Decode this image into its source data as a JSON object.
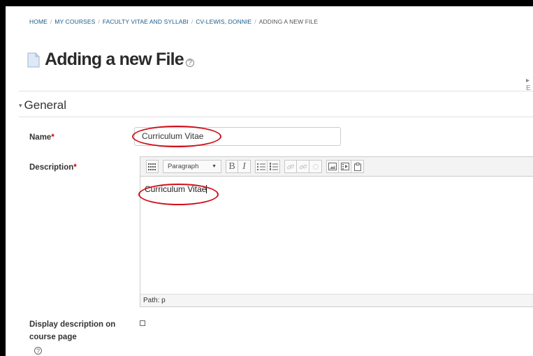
{
  "breadcrumb": {
    "items": [
      "HOME",
      "MY COURSES",
      "FACULTY VITAE AND SYLLABI",
      "CV-LEWIS, DONNIE"
    ],
    "current": "ADDING A NEW FILE",
    "separator": "/"
  },
  "page": {
    "title": "Adding a new File",
    "help_glyph": "?"
  },
  "header": {
    "expand_label": "▸ E"
  },
  "section": {
    "title": "General",
    "caret": "▾"
  },
  "form": {
    "name_label": "Name",
    "name_value": "Curriculum Vitae",
    "description_label": "Description",
    "required_mark": "*",
    "editor": {
      "format_value": "Paragraph",
      "bold": "B",
      "italic": "I",
      "content": "Curriculum Vitae",
      "path": "Path: p"
    },
    "display_description_label_line1": "Display description on",
    "display_description_label_line2": "course page",
    "display_description_checked": false
  },
  "colors": {
    "link": "#1a5c8a",
    "annotation": "#d0101a",
    "required": "#c00000"
  }
}
